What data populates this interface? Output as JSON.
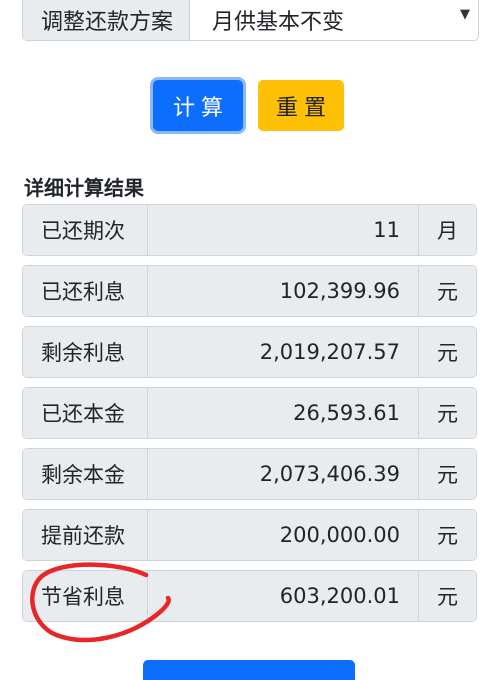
{
  "adjust_plan": {
    "label": "调整还款方案",
    "selected": "月供基本不变",
    "caret_icon": "caret-down-icon"
  },
  "buttons": {
    "calculate_label": "计算",
    "reset_label": "重置"
  },
  "colors": {
    "primary": "#0d6efd",
    "warning": "#ffc107",
    "label_bg": "#e9ecef",
    "annotation_red": "#e8262a"
  },
  "results": {
    "title": "详细计算结果",
    "rows": [
      {
        "label": "已还期次",
        "value": "11",
        "unit": "月"
      },
      {
        "label": "已还利息",
        "value": "102,399.96",
        "unit": "元"
      },
      {
        "label": "剩余利息",
        "value": "2,019,207.57",
        "unit": "元"
      },
      {
        "label": "已还本金",
        "value": "26,593.61",
        "unit": "元"
      },
      {
        "label": "剩余本金",
        "value": "2,073,406.39",
        "unit": "元"
      },
      {
        "label": "提前还款",
        "value": "200,000.00",
        "unit": "元"
      },
      {
        "label": "节省利息",
        "value": "603,200.01",
        "unit": "元"
      }
    ]
  }
}
